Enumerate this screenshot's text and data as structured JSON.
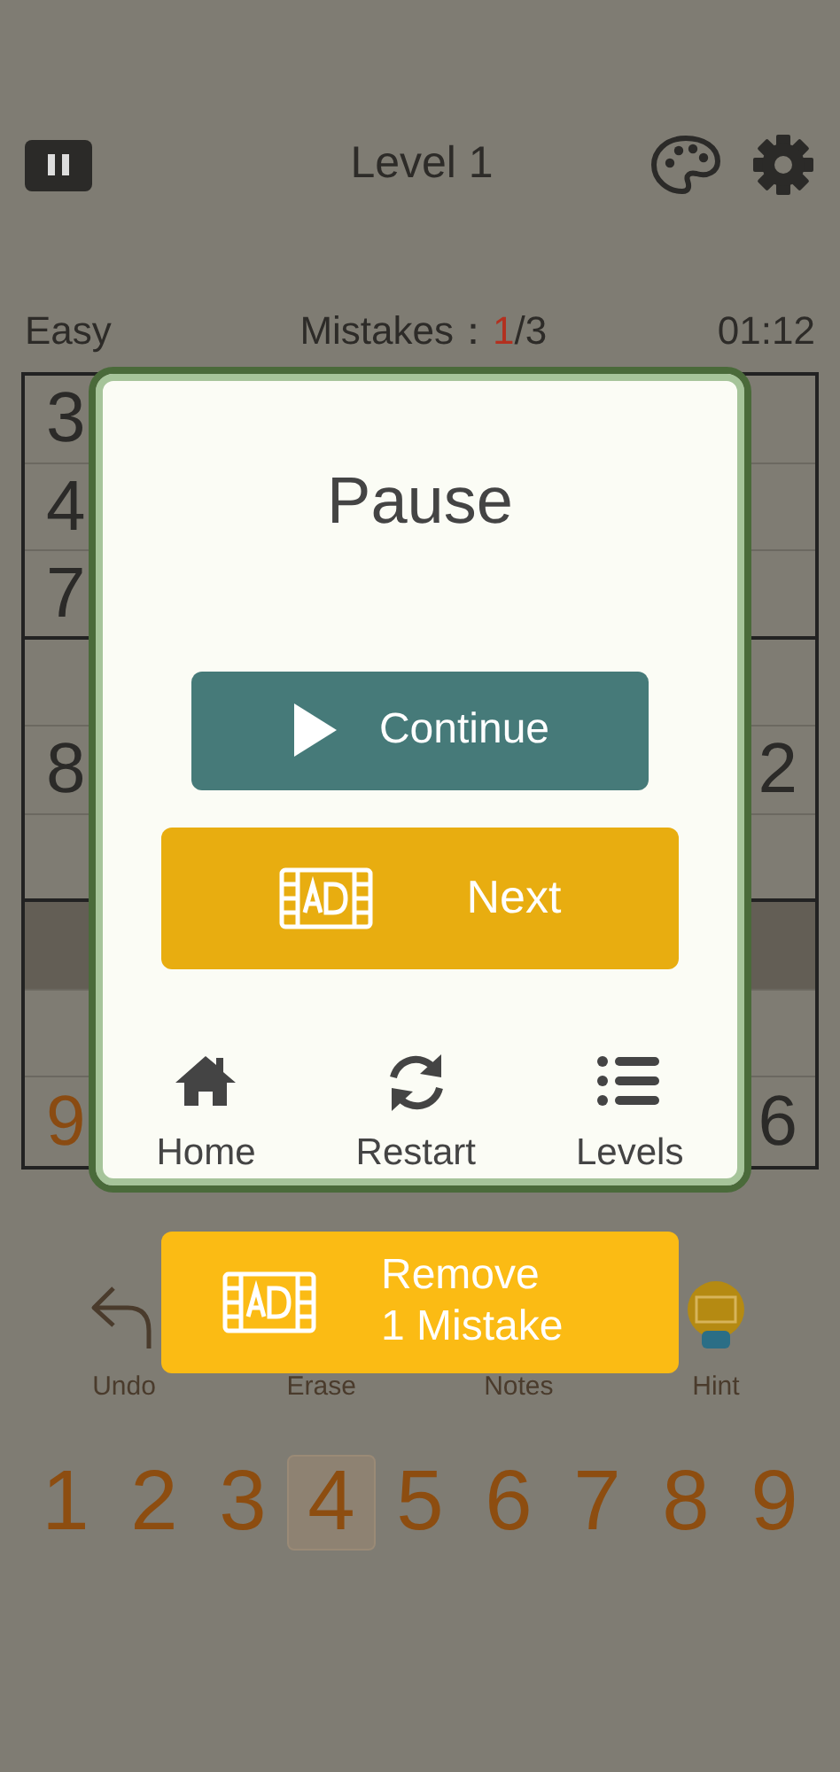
{
  "header": {
    "title": "Level 1"
  },
  "info": {
    "difficulty": "Easy",
    "mistakes_label": "Mistakes：",
    "mistakes_count": "1",
    "mistakes_total": "/3",
    "timer": "01:12"
  },
  "board": {
    "rows": [
      {
        "highlighted": false,
        "first": {
          "value": "3",
          "kind": "given"
        }
      },
      {
        "highlighted": false,
        "first": {
          "value": "4",
          "kind": "given"
        }
      },
      {
        "highlighted": false,
        "first": {
          "value": "7",
          "kind": "given"
        }
      },
      {
        "highlighted": false
      },
      {
        "highlighted": false,
        "first": {
          "value": "8",
          "kind": "given"
        },
        "last": {
          "value": "2",
          "kind": "given"
        }
      },
      {
        "highlighted": false
      },
      {
        "highlighted": true
      },
      {
        "highlighted": false
      },
      {
        "highlighted": false,
        "first": {
          "value": "9",
          "kind": "entered"
        },
        "last": {
          "value": "6",
          "kind": "given"
        }
      }
    ]
  },
  "dialog": {
    "title": "Pause",
    "continue_button": "Continue",
    "next_button": "Next",
    "actions": [
      {
        "label": "Home",
        "kind": "home"
      },
      {
        "label": "Restart",
        "kind": "restart"
      },
      {
        "label": "Levels",
        "kind": "levels"
      }
    ]
  },
  "toolbar": [
    {
      "label": "Undo",
      "kind": "undo"
    },
    {
      "label": "Erase",
      "kind": "erase"
    },
    {
      "label": "Notes",
      "kind": "notes"
    },
    {
      "label": "Hint",
      "kind": "hint"
    }
  ],
  "ad_button": {
    "line_1": "Remove",
    "line_2": "1 Mistake"
  },
  "numpad": [
    {
      "label": "1",
      "selected": false
    },
    {
      "label": "2",
      "selected": false
    },
    {
      "label": "3",
      "selected": false
    },
    {
      "label": "4",
      "selected": true
    },
    {
      "label": "5",
      "selected": false
    },
    {
      "label": "6",
      "selected": false
    },
    {
      "label": "7",
      "selected": false
    },
    {
      "label": "8",
      "selected": false
    },
    {
      "label": "9",
      "selected": false
    }
  ]
}
